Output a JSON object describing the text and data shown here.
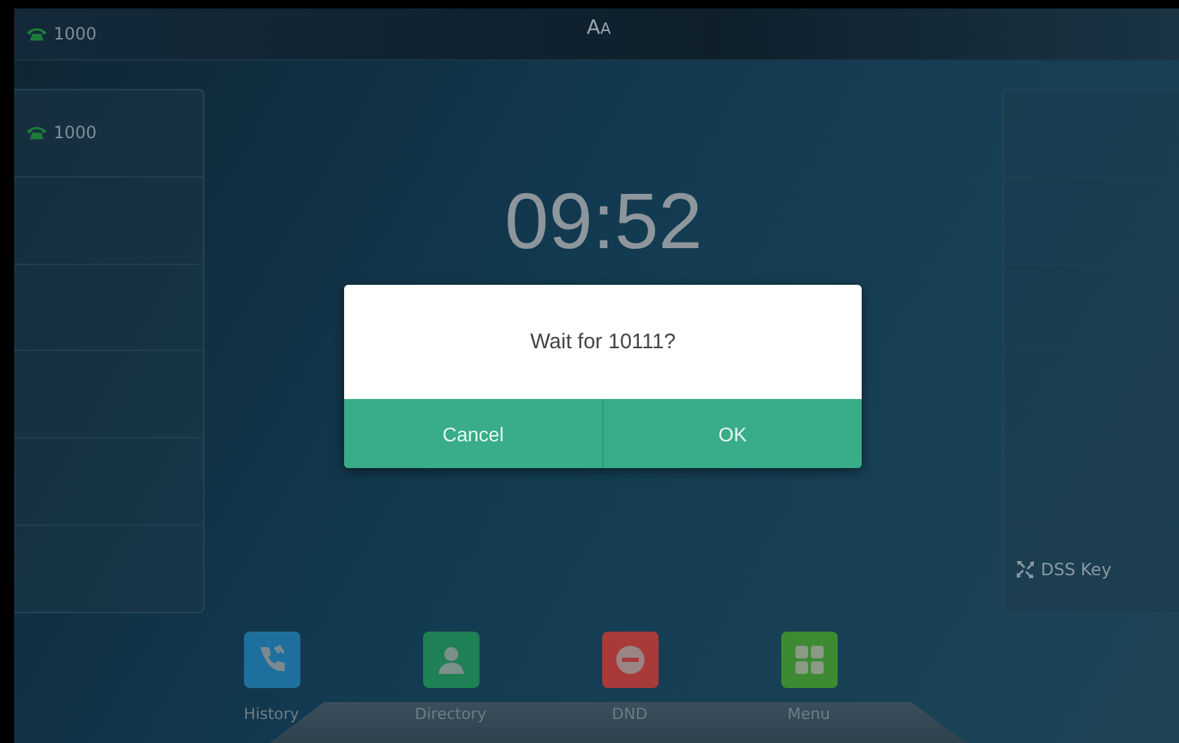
{
  "status_bar": {
    "account": "1000",
    "font_icon": "AA"
  },
  "line_keys": [
    {
      "label": "1000",
      "kind": "line"
    },
    {
      "kind": "empty"
    },
    {
      "kind": "empty"
    },
    {
      "kind": "empty"
    },
    {
      "kind": "empty"
    },
    {
      "kind": "empty"
    }
  ],
  "dss_keys": [
    {
      "kind": "empty"
    },
    {
      "kind": "empty"
    },
    {
      "kind": "empty"
    },
    {
      "kind": "empty"
    },
    {
      "kind": "empty"
    },
    {
      "label": "DSS Key",
      "kind": "dss"
    }
  ],
  "clock": {
    "time": "09:52"
  },
  "dialog": {
    "message": "Wait for 10111?",
    "buttons": [
      "Cancel",
      "OK"
    ]
  },
  "dock": [
    {
      "label": "History",
      "kind": "history"
    },
    {
      "label": "Directory",
      "kind": "directory"
    },
    {
      "label": "DND",
      "kind": "dnd"
    },
    {
      "label": "Menu",
      "kind": "menu"
    }
  ]
}
